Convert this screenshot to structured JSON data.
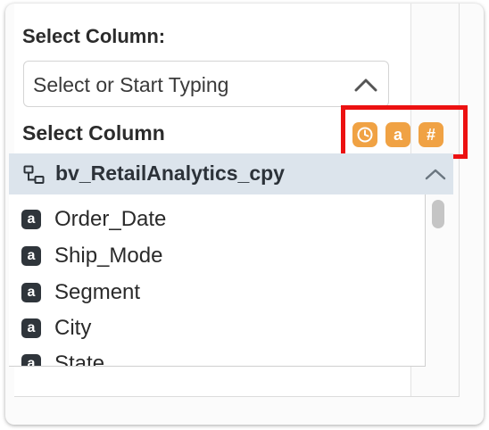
{
  "field": {
    "label": "Select Column:",
    "placeholder": "Select or Start Typing"
  },
  "dropdown": {
    "heading": "Select Column",
    "type_filters": [
      {
        "icon": "clock-icon",
        "glyph": ""
      },
      {
        "icon": "text-type-icon",
        "glyph": "a"
      },
      {
        "icon": "number-type-icon",
        "glyph": "#"
      }
    ],
    "dataset": {
      "name": "bv_RetailAnalytics_cpy",
      "icon": "dataset-tree-icon"
    },
    "columns": [
      {
        "label": "Order_Date",
        "type_glyph": "a"
      },
      {
        "label": "Ship_Mode",
        "type_glyph": "a"
      },
      {
        "label": "Segment",
        "type_glyph": "a"
      },
      {
        "label": "City",
        "type_glyph": "a"
      },
      {
        "label": "State",
        "type_glyph": "a"
      }
    ]
  },
  "colors": {
    "highlight": "#ec1111",
    "type_filter_bg": "#f0a244",
    "dataset_row_bg": "#dce4ec",
    "badge_bg": "#2f353b"
  }
}
